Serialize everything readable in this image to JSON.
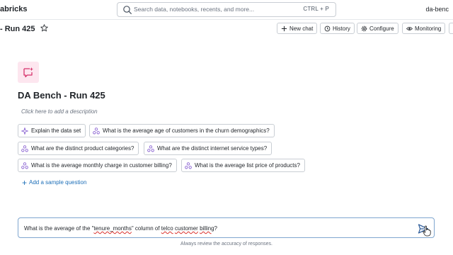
{
  "header": {
    "brand": "abricks",
    "search_placeholder": "Search data, notebooks, recents, and more...",
    "search_shortcut": "CTRL + P",
    "workspace": "da-benc"
  },
  "page": {
    "title": "- Run 425",
    "actions": [
      {
        "label": "New chat",
        "icon": "plus-icon"
      },
      {
        "label": "History",
        "icon": "history-icon"
      },
      {
        "label": "Configure",
        "icon": "gear-icon"
      },
      {
        "label": "Monitoring",
        "icon": "eye-icon"
      }
    ]
  },
  "space": {
    "title": "DA Bench - Run 425",
    "description_placeholder": "Click here to add a description",
    "sample_questions": [
      "Explain the data set",
      "What is the average age of customers in the churn demographics?",
      "What are the distinct product categories?",
      "What are the distinct internet service types?",
      "What is the average monthly charge in customer billing?",
      "What is the average list price of products?"
    ],
    "add_sample_label": "Add a sample question"
  },
  "chat": {
    "input_prefix": "What is the average of the \"",
    "input_word1": "tenure_months",
    "input_mid": "\" column of ",
    "input_word2": "telco",
    "input_space": " ",
    "input_word3": "customer",
    "input_space2": " ",
    "input_word4": "billing",
    "input_suffix": "?",
    "disclaimer": "Always review the accuracy of responses."
  },
  "colors": {
    "accent_link": "#1d6fb8",
    "app_icon_bg": "#fde6ef",
    "app_icon_fg": "#d6336c",
    "chip_icon": "#8a63d2"
  }
}
